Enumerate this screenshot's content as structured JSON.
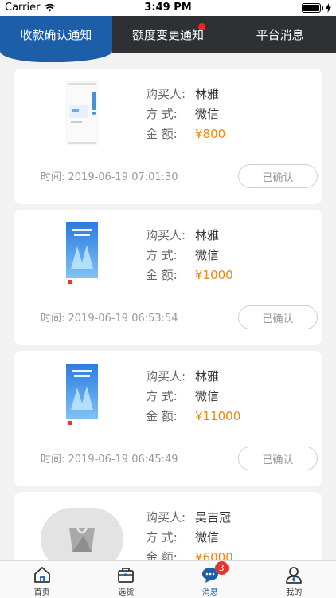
{
  "status_bar": {
    "carrier": "Carrier",
    "time": "3:49 PM",
    "battery_level": 1.0
  },
  "tabs": [
    {
      "label": "收款确认通知",
      "active": true
    },
    {
      "label": "额度变更通知",
      "active": false,
      "has_dot": true
    },
    {
      "label": "平台消息",
      "active": false
    }
  ],
  "labels": {
    "buyer": "购买人:",
    "method": "方   式:",
    "amount": "金   额:"
  },
  "cards": [
    {
      "buyer": "林雅",
      "method": "微信",
      "amount": "¥800",
      "time": "时间: 2019-06-19 07:01:30",
      "status": "已确认",
      "thumb": "screenshot"
    },
    {
      "buyer": "林雅",
      "method": "微信",
      "amount": "¥1000",
      "time": "时间: 2019-06-19 06:53:54",
      "status": "已确认",
      "thumb": "poster"
    },
    {
      "buyer": "林雅",
      "method": "微信",
      "amount": "¥11000",
      "time": "时间: 2019-06-19 06:45:49",
      "status": "已确认",
      "thumb": "poster"
    },
    {
      "buyer": "吴吉冠",
      "method": "微信",
      "amount": "¥6000",
      "thumb": "placeholder"
    }
  ],
  "bottom_nav": [
    {
      "label": "首页",
      "icon": "home-icon",
      "active": false
    },
    {
      "label": "选货",
      "icon": "bag-icon",
      "active": false
    },
    {
      "label": "消息",
      "icon": "message-icon",
      "active": true,
      "badge": "3"
    },
    {
      "label": "我的",
      "icon": "user-icon",
      "active": false
    }
  ],
  "colors": {
    "accent": "#1d5ea8",
    "tab_bar": "#2f3033",
    "amount": "#e68a17",
    "badge": "#e8322e"
  }
}
